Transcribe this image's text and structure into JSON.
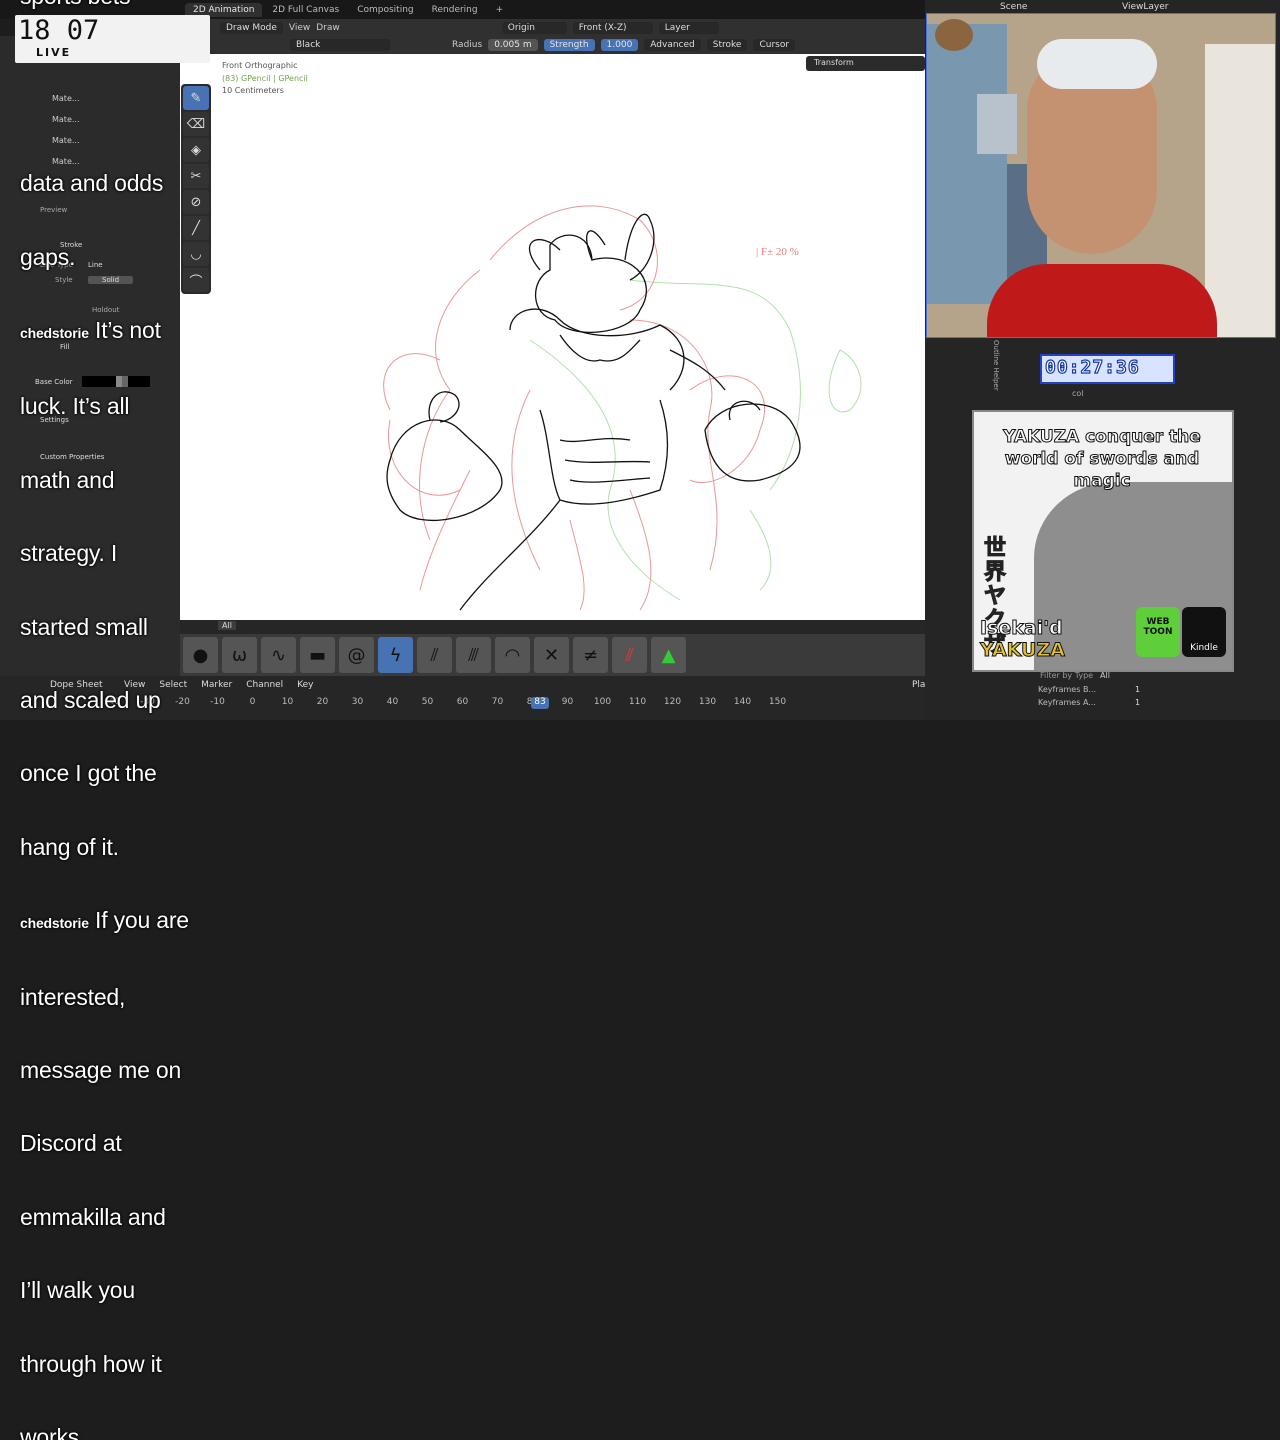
{
  "workspace_tabs": [
    "2D Animation",
    "2D Full Canvas",
    "Compositing",
    "Rendering",
    "+"
  ],
  "header": {
    "mode": "Draw Mode",
    "view": "View",
    "draw": "Draw",
    "origin": "Origin",
    "plane": "Front (X-Z)",
    "layer": "Layer",
    "material": "Black",
    "radius_label": "Radius",
    "radius_value": "0.005 m",
    "strength_label": "Strength",
    "strength_value": "1.000",
    "advanced": "Advanced",
    "stroke": "Stroke",
    "cursor": "Cursor"
  },
  "viewport": {
    "view_name": "Front Orthographic",
    "object": "(83) GPencil | GPencil",
    "scale": "10 Centimeters",
    "transform_tab": "Transform",
    "annotation": "| F±  20 %"
  },
  "clock": {
    "time": "18 07",
    "live": "LIVE"
  },
  "subtitle": {
    "line_top": "sports bets",
    "lines": [
      "data and odds",
      "gaps.",
      "It’s not",
      "luck. It’s all",
      "math and",
      "strategy. I",
      "started small",
      "and scaled up",
      "once I got the",
      "hang of it.",
      "If you are",
      "interested,",
      "message me on",
      "Discord at",
      "emmakilla and",
      "I’ll walk you",
      "through how it",
      "works."
    ],
    "chat_name_1": "chedstorie",
    "chat_name_2": "chedstorie"
  },
  "properties": {
    "materials": [
      "Mate...",
      "Mate...",
      "Mate...",
      "Mate..."
    ],
    "preview": "Preview",
    "stroke": "Stroke",
    "line_type": "Line Type",
    "line_value": "Line",
    "style": "Style",
    "style_value": "Solid",
    "holdout": "Holdout",
    "fill": "Fill",
    "base_color": "Base Color",
    "settings": "Settings",
    "custom_properties": "Custom Properties"
  },
  "brush_bar": {
    "tab": "All"
  },
  "timeline": {
    "editor": "Dope Sheet",
    "menus": [
      "View",
      "Select",
      "Marker",
      "Channel",
      "Key"
    ],
    "playhead_label": "Playhead",
    "ticks": [
      "-40",
      "-30",
      "-20",
      "-10",
      "0",
      "10",
      "20",
      "30",
      "40",
      "50",
      "60",
      "70",
      "80",
      "90",
      "100",
      "110",
      "120",
      "130",
      "140",
      "150"
    ],
    "current_frame": "83"
  },
  "right_panel": {
    "scene": "Scene",
    "view_layer": "ViewLayer",
    "timer": "00:27:36",
    "col": "col",
    "filter": "Filter by Type",
    "filter_value": "All",
    "kf_label_1": "Keyframes B...",
    "kf_val_1": "1",
    "kf_label_2": "Keyframes A...",
    "kf_val_2": "1",
    "outline_helper": "Outline Helper"
  },
  "manga": {
    "title": "YAKUZA conquer the world of swords and magic",
    "kanji": "世界ヤクザ",
    "line1": "Isekai'd",
    "line2": "YAKUZA",
    "webtoon": "WEB TOON",
    "kindle": "Kindle"
  },
  "colors": {
    "blender_bg": "#303030",
    "accent": "#4772b3",
    "canvas": "#ffffff",
    "sketch_black": "#111111",
    "sketch_red": "#e47d7d",
    "sketch_green": "#9ed99a"
  }
}
